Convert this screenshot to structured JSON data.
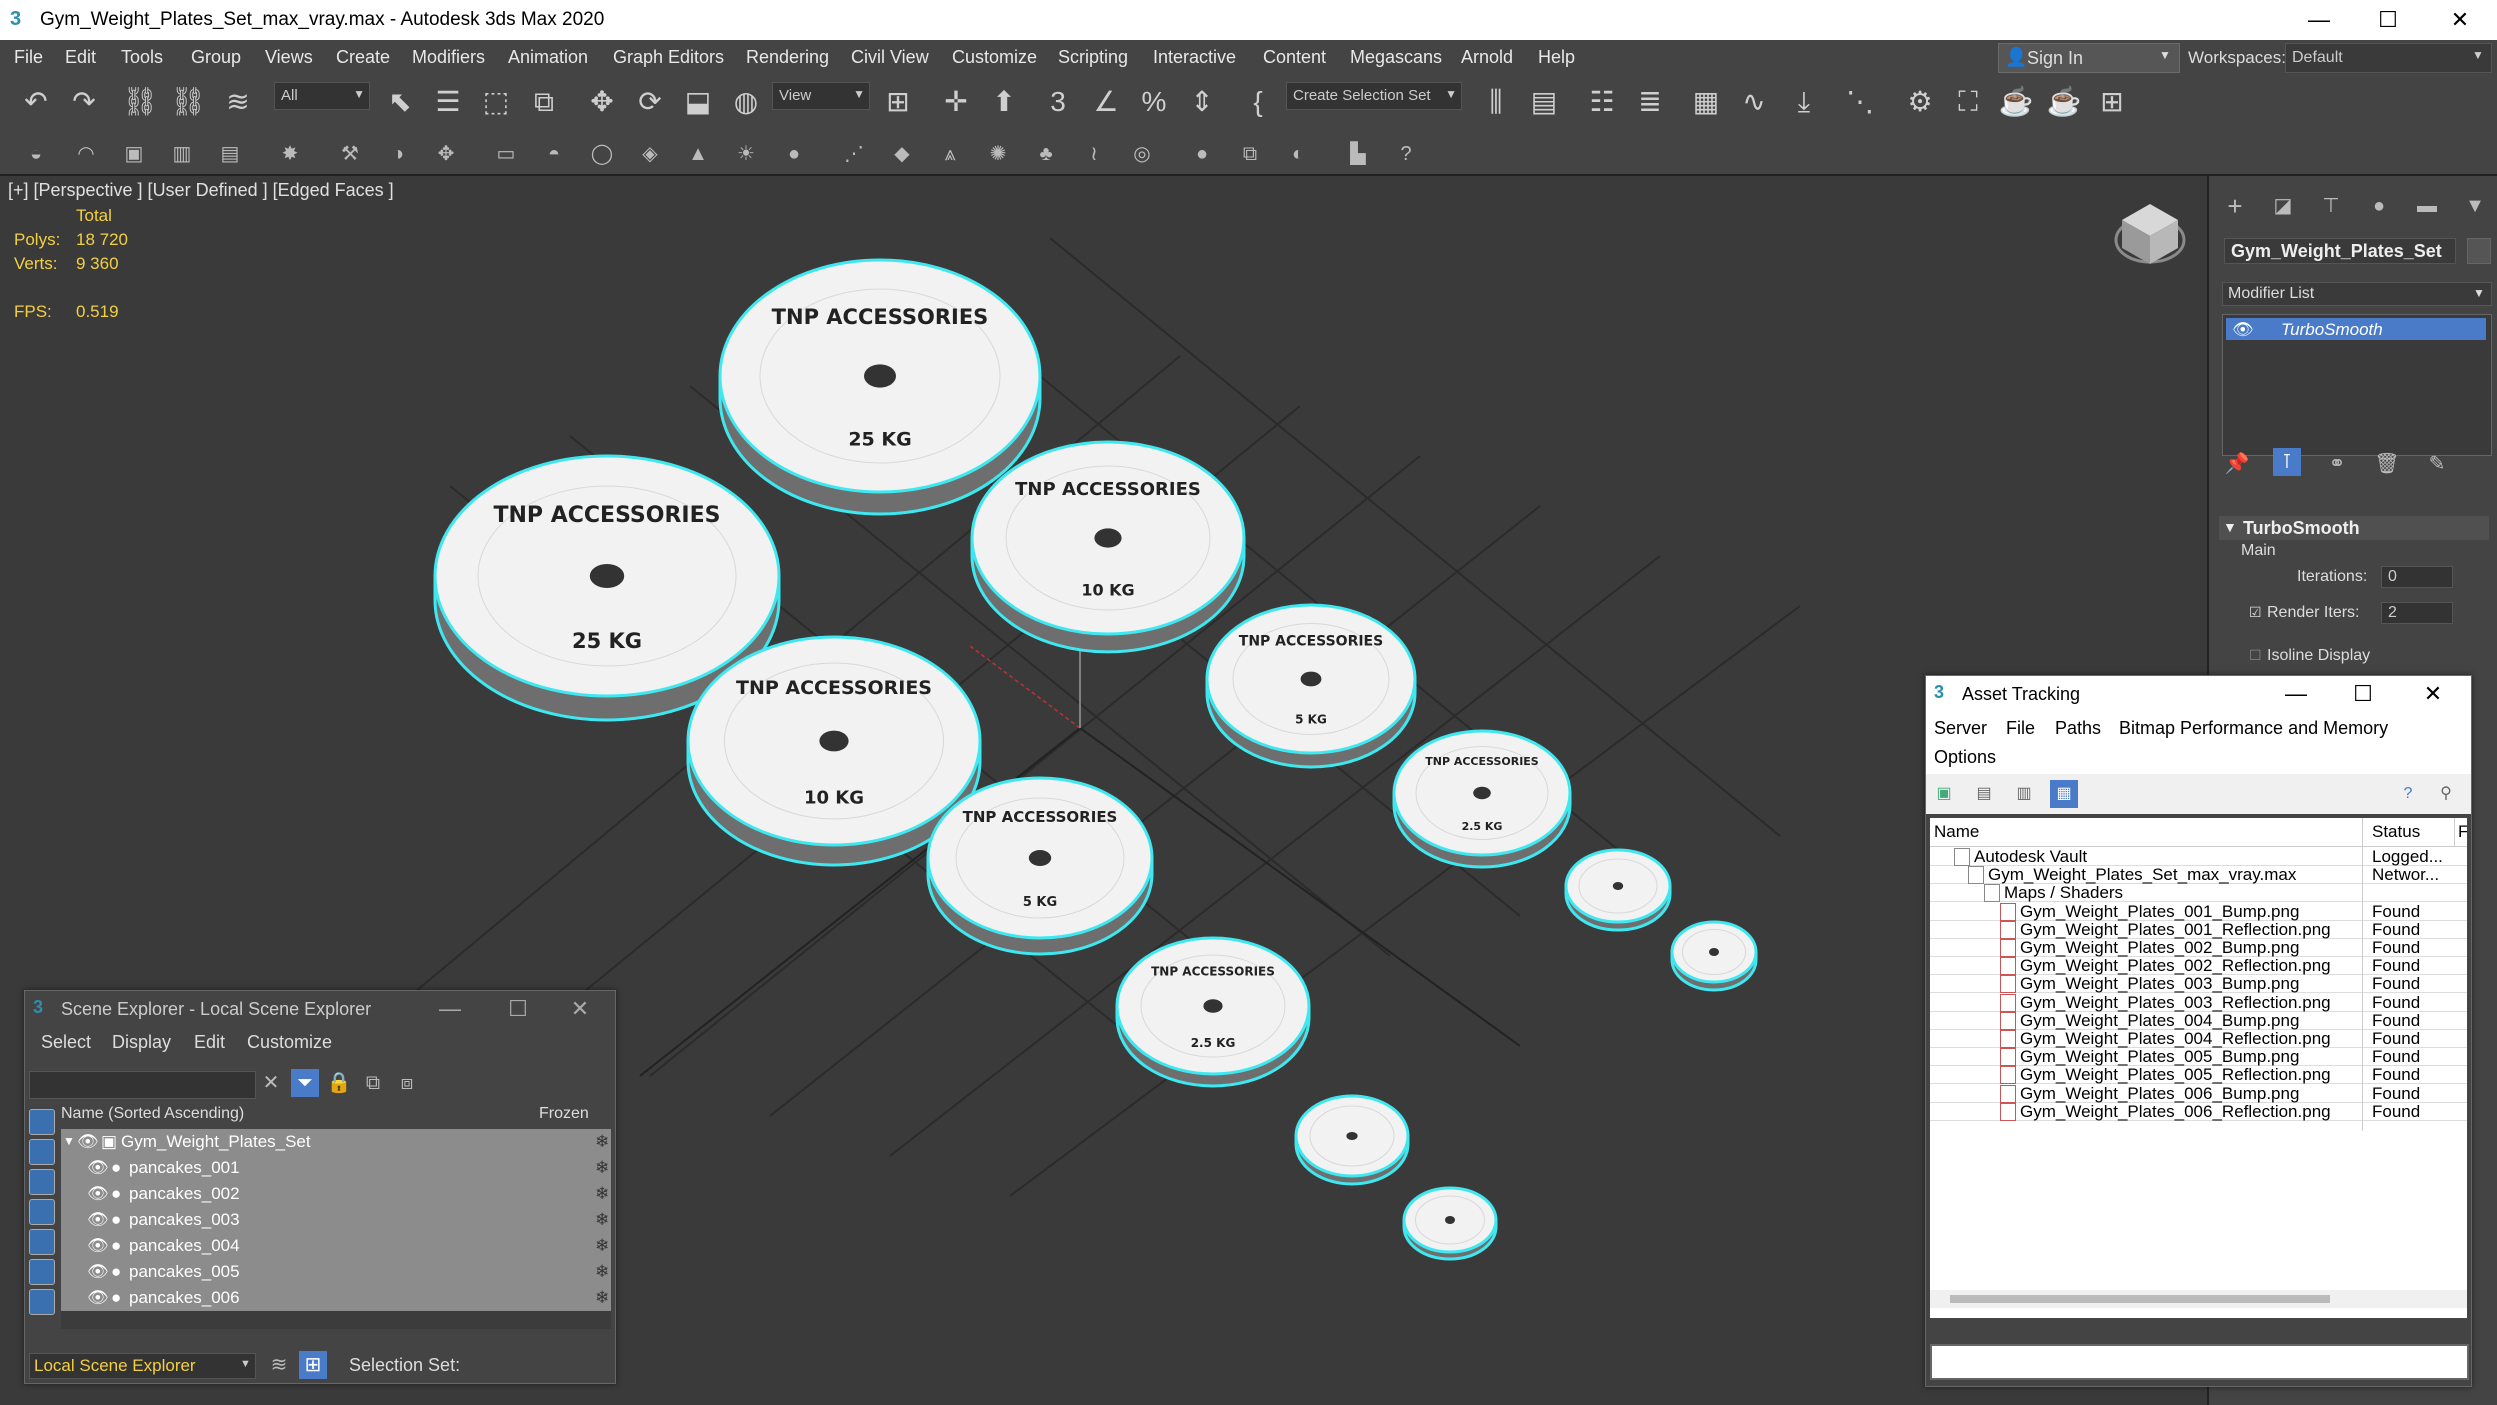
{
  "window": {
    "title": "Gym_Weight_Plates_Set_max_vray.max - Autodesk 3ds Max 2020",
    "minimize": "—",
    "maximize": "☐",
    "close": "✕"
  },
  "menu": [
    "File",
    "Edit",
    "Tools",
    "Group",
    "Views",
    "Create",
    "Modifiers",
    "Animation",
    "Graph Editors",
    "Rendering",
    "Civil View",
    "Customize",
    "Scripting",
    "Interactive",
    "Content",
    "Megascans",
    "Arnold",
    "Help"
  ],
  "signin": {
    "label": "Sign In"
  },
  "workspaces": {
    "label": "Workspaces:",
    "value": "Default"
  },
  "toolbar": {
    "filter_all": "All",
    "ref_coord": "View",
    "selection_set": "Create Selection Set",
    "snap3": "3"
  },
  "viewport": {
    "label": "[+] [Perspective ] [User Defined ] [Edged Faces ]",
    "stats": {
      "total_label": "Total",
      "polys_label": "Polys:",
      "polys_value": "18 720",
      "verts_label": "Verts:",
      "verts_value": "9 360",
      "fps_label": "FPS:",
      "fps_value": "0.519"
    },
    "plates": [
      {
        "text": "TNP ACCESSORIES",
        "weight": "25 KG"
      },
      {
        "text": "TNP ACCESSORIES",
        "weight": "25 KG"
      },
      {
        "text": "TNP ACCESSORIES",
        "weight": "10 KG"
      },
      {
        "text": "TNP ACCESSORIES",
        "weight": "10 KG"
      },
      {
        "text": "TNP ACCESSORIES",
        "weight": "5 KG"
      },
      {
        "text": "TNP ACCESSORIES",
        "weight": "5 KG"
      },
      {
        "text": "TNP ACCESSORIES",
        "weight": "2.5 KG"
      },
      {
        "text": "TNP ACCESSORIES",
        "weight": "2.5 KG"
      }
    ]
  },
  "command_panel": {
    "object_name": "Gym_Weight_Plates_Set",
    "modifier_list": "Modifier List",
    "modifier": "TurboSmooth",
    "rollout_title": "TurboSmooth",
    "main_label": "Main",
    "iterations_label": "Iterations:",
    "iterations_value": "0",
    "render_iters_label": "Render Iters:",
    "render_iters_value": "2",
    "isoline_label": "Isoline Display"
  },
  "asset_tracking": {
    "title": "Asset Tracking",
    "menu": [
      "Server",
      "File",
      "Paths",
      "Bitmap Performance and Memory",
      "Options"
    ],
    "col_name": "Name",
    "col_status": "Status",
    "col_extra": "F",
    "rows": [
      {
        "name": "Autodesk Vault",
        "status": "Logged...",
        "indent": 0
      },
      {
        "name": "Gym_Weight_Plates_Set_max_vray.max",
        "status": "Networ...",
        "indent": 1
      },
      {
        "name": "Maps / Shaders",
        "status": "",
        "indent": 2
      },
      {
        "name": "Gym_Weight_Plates_001_Bump.png",
        "status": "Found",
        "indent": 3
      },
      {
        "name": "Gym_Weight_Plates_001_Reflection.png",
        "status": "Found",
        "indent": 3
      },
      {
        "name": "Gym_Weight_Plates_002_Bump.png",
        "status": "Found",
        "indent": 3
      },
      {
        "name": "Gym_Weight_Plates_002_Reflection.png",
        "status": "Found",
        "indent": 3
      },
      {
        "name": "Gym_Weight_Plates_003_Bump.png",
        "status": "Found",
        "indent": 3
      },
      {
        "name": "Gym_Weight_Plates_003_Reflection.png",
        "status": "Found",
        "indent": 3
      },
      {
        "name": "Gym_Weight_Plates_004_Bump.png",
        "status": "Found",
        "indent": 3
      },
      {
        "name": "Gym_Weight_Plates_004_Reflection.png",
        "status": "Found",
        "indent": 3
      },
      {
        "name": "Gym_Weight_Plates_005_Bump.png",
        "status": "Found",
        "indent": 3
      },
      {
        "name": "Gym_Weight_Plates_005_Reflection.png",
        "status": "Found",
        "indent": 3
      },
      {
        "name": "Gym_Weight_Plates_006_Bump.png",
        "status": "Found",
        "indent": 3
      },
      {
        "name": "Gym_Weight_Plates_006_Reflection.png",
        "status": "Found",
        "indent": 3
      }
    ]
  },
  "scene_explorer": {
    "title": "Scene Explorer - Local Scene Explorer",
    "menu": [
      "Select",
      "Display",
      "Edit",
      "Customize"
    ],
    "col_name": "Name (Sorted Ascending)",
    "col_frozen": "Frozen",
    "root": "Gym_Weight_Plates_Set",
    "items": [
      "pancakes_001",
      "pancakes_002",
      "pancakes_003",
      "pancakes_004",
      "pancakes_005",
      "pancakes_006"
    ],
    "footer_explorer": "Local Scene Explorer",
    "footer_selset": "Selection Set:"
  },
  "colors": {
    "accent_blue": "#4a7bc8",
    "stat_yellow": "#f3d040",
    "selection_cyan": "#3ee8f0",
    "viewport_bg": "#3a3a3a"
  }
}
